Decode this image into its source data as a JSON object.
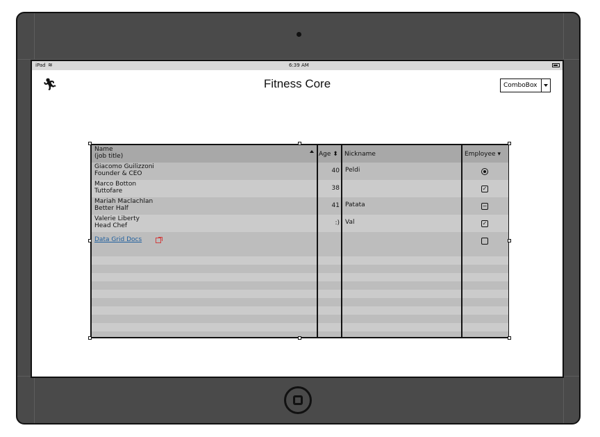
{
  "device": {
    "type": "iPad"
  },
  "status_bar": {
    "carrier": "iPad",
    "time": "6:39 AM"
  },
  "header": {
    "icon": "runner-icon",
    "title": "Fitness Core",
    "combobox": {
      "value": "ComboBox"
    }
  },
  "grid": {
    "columns": {
      "name": "Name",
      "name_sub": "(job title)",
      "age": "Age",
      "nickname": "Nickname",
      "employee": "Employee"
    },
    "rows": [
      {
        "name": "Giacomo Guilizzoni",
        "title": "Founder & CEO",
        "age": "40",
        "nickname": "Peldi",
        "employee": "radio"
      },
      {
        "name": "Marco Botton",
        "title": "Tuttofare",
        "age": "38",
        "nickname": "",
        "employee": "checked"
      },
      {
        "name": "Mariah Maclachlan",
        "title": "Better Half",
        "age": "41",
        "nickname": "Patata",
        "employee": "indeterminate"
      },
      {
        "name": "Valerie Liberty",
        "title": "Head Chef",
        "age": ":)",
        "nickname": "Val",
        "employee": "checked"
      }
    ],
    "link": {
      "label": "Data Grid Docs"
    },
    "link_row_employee": "unchecked"
  },
  "colors": {
    "header_bg": "#a8a8a8",
    "row_dark": "#bdbdbd",
    "row_light": "#cbcbcb",
    "link": "#1f5f9e",
    "device_frame": "#4a4a4a"
  }
}
